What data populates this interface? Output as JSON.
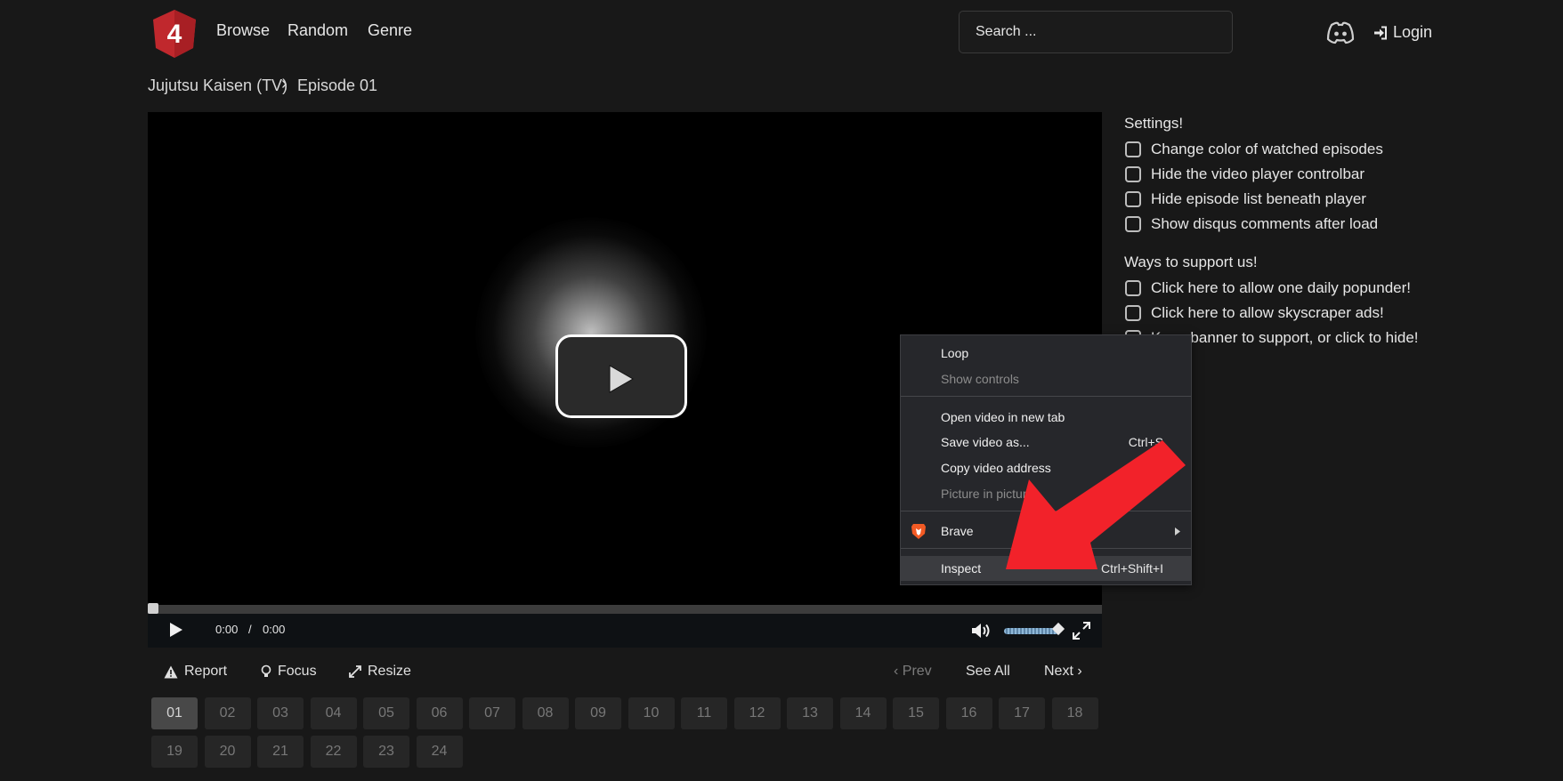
{
  "header": {
    "logo_text": "4",
    "nav": [
      "Browse",
      "Random",
      "Genre"
    ],
    "search_placeholder": "Search ...",
    "login_label": "Login"
  },
  "breadcrumb": {
    "series": "Jujutsu Kaisen (TV)",
    "separator": "›",
    "episode": "Episode 01"
  },
  "player": {
    "current_time": "0:00",
    "time_separator": "/",
    "duration": "0:00",
    "progress": 0,
    "volume": 0.95
  },
  "actions": {
    "report": "Report",
    "focus": "Focus",
    "resize": "Resize",
    "prev": "‹ Prev",
    "see_all": "See All",
    "next": "Next ›"
  },
  "episodes": [
    "01",
    "02",
    "03",
    "04",
    "05",
    "06",
    "07",
    "08",
    "09",
    "10",
    "11",
    "12",
    "13",
    "14",
    "15",
    "16",
    "17",
    "18",
    "19",
    "20",
    "21",
    "22",
    "23",
    "24"
  ],
  "active_episode": "01",
  "settings": {
    "title": "Settings!",
    "options": [
      "Change color of watched episodes",
      "Hide the video player controlbar",
      "Hide episode list beneath player",
      "Show disqus comments after load"
    ]
  },
  "support": {
    "title": "Ways to support us!",
    "options": [
      "Click here to allow one daily popunder!",
      "Click here to allow skyscraper ads!",
      "Keep banner to support, or click to hide!"
    ]
  },
  "context_menu": {
    "items": [
      {
        "label": "Loop",
        "shortcut": "",
        "disabled": false
      },
      {
        "label": "Show controls",
        "shortcut": "",
        "disabled": true
      },
      {
        "label": "Open video in new tab",
        "shortcut": "",
        "disabled": false
      },
      {
        "label": "Save video as...",
        "shortcut": "Ctrl+S",
        "disabled": false
      },
      {
        "label": "Copy video address",
        "shortcut": "",
        "disabled": false
      },
      {
        "label": "Picture in picture",
        "shortcut": "",
        "disabled": true
      },
      {
        "label": "Brave",
        "shortcut": "",
        "disabled": false
      },
      {
        "label": "Inspect",
        "shortcut": "Ctrl+Shift+I",
        "disabled": false
      }
    ]
  },
  "colors": {
    "background": "#181818",
    "logo_red": "#c0282d",
    "menu_bg": "#26272b",
    "arrow_red": "#f2222a",
    "brave_orange": "#f25a24"
  },
  "icons": [
    "logo-shield-icon",
    "discord-icon",
    "sign-in-icon",
    "chevron-right-icon",
    "play-icon",
    "volume-icon",
    "fullscreen-icon",
    "warning-icon",
    "lightbulb-icon",
    "resize-icon",
    "brave-icon",
    "submenu-arrow-icon",
    "red-arrow-annotation"
  ]
}
